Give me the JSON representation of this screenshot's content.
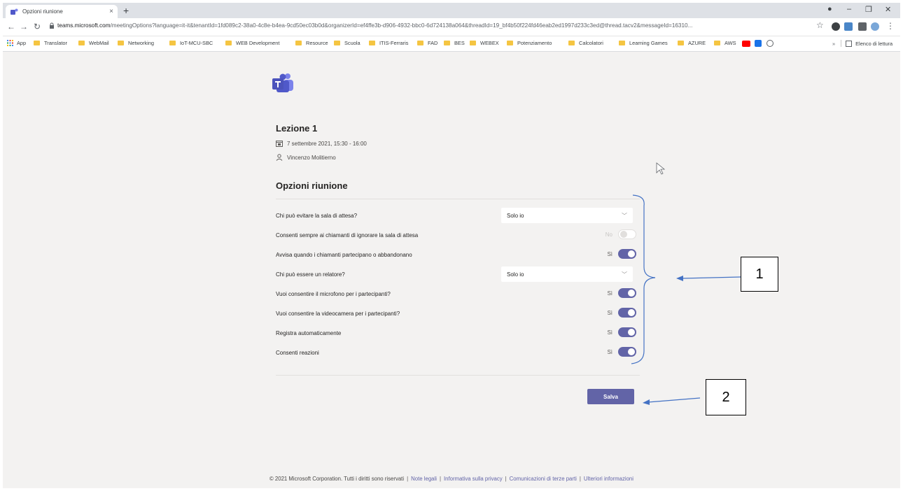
{
  "browser": {
    "tab_title": "Opzioni riunione",
    "tab_close": "×",
    "new_tab": "+",
    "url_domain": "teams.microsoft.com",
    "url_path": "/meetingOptions?language=it-it&tenantId=1fd089c2-38a0-4c8e-b4ea-9cd50ec03b0d&organizerId=ef4ffe3b-d906-4932-bbc0-6d724138a064&threadId=19_bf4b50f224fd46eab2ed1997d233c3ed@thread.tacv2&messageId=16310...",
    "bookmarks": [
      "App",
      "Translator",
      "WebMail",
      "Networking",
      "IoT-MCU-SBC",
      "WEB Development",
      "Resource",
      "Scuola",
      "ITIS-Ferraris",
      "FAD",
      "BES",
      "WEBEX",
      "Potenziamento",
      "Calcolatori",
      "Learning Games",
      "AZURE",
      "AWS"
    ],
    "reading_list": "Elenco di lettura",
    "more_bookmarks": "»"
  },
  "meeting": {
    "title": "Lezione 1",
    "datetime": "7 settembre 2021, 15:30 - 16:00",
    "organizer": "Vincenzo Molitierno"
  },
  "options": {
    "section_title": "Opzioni riunione",
    "lobby_bypass_label": "Chi può evitare la sala di attesa?",
    "lobby_bypass_value": "Solo io",
    "callers_bypass_label": "Consenti sempre ai chiamanti di ignorare la sala di attesa",
    "callers_bypass_state": "No",
    "announce_label": "Avvisa quando i chiamanti partecipano o abbandonano",
    "announce_state": "Sì",
    "presenter_label": "Chi può essere un relatore?",
    "presenter_value": "Solo io",
    "mic_label": "Vuoi consentire il microfono per i partecipanti?",
    "mic_state": "Sì",
    "camera_label": "Vuoi consentire la videocamera per i partecipanti?",
    "camera_state": "Sì",
    "autorecord_label": "Registra automaticamente",
    "autorecord_state": "Sì",
    "reactions_label": "Consenti reazioni",
    "reactions_state": "Sì",
    "save_label": "Salva"
  },
  "footer": {
    "copyright": "© 2021 Microsoft Corporation. Tutti i diritti sono riservati",
    "legal": "Note legali",
    "privacy": "Informativa sulla privacy",
    "third_party": "Comunicazioni di terze parti",
    "more_info": "Ulteriori informazioni",
    "separator": "|"
  },
  "annotations": {
    "callout_1": "1",
    "callout_2": "2"
  },
  "colors": {
    "teams_accent": "#6264a7",
    "annotation_line": "#4472c4"
  },
  "icons": [
    "teams-logo-icon",
    "calendar-icon",
    "person-icon",
    "chevron-down-icon",
    "lock-icon",
    "apps-grid-icon",
    "folder-icon",
    "star-icon",
    "cursor-icon"
  ]
}
